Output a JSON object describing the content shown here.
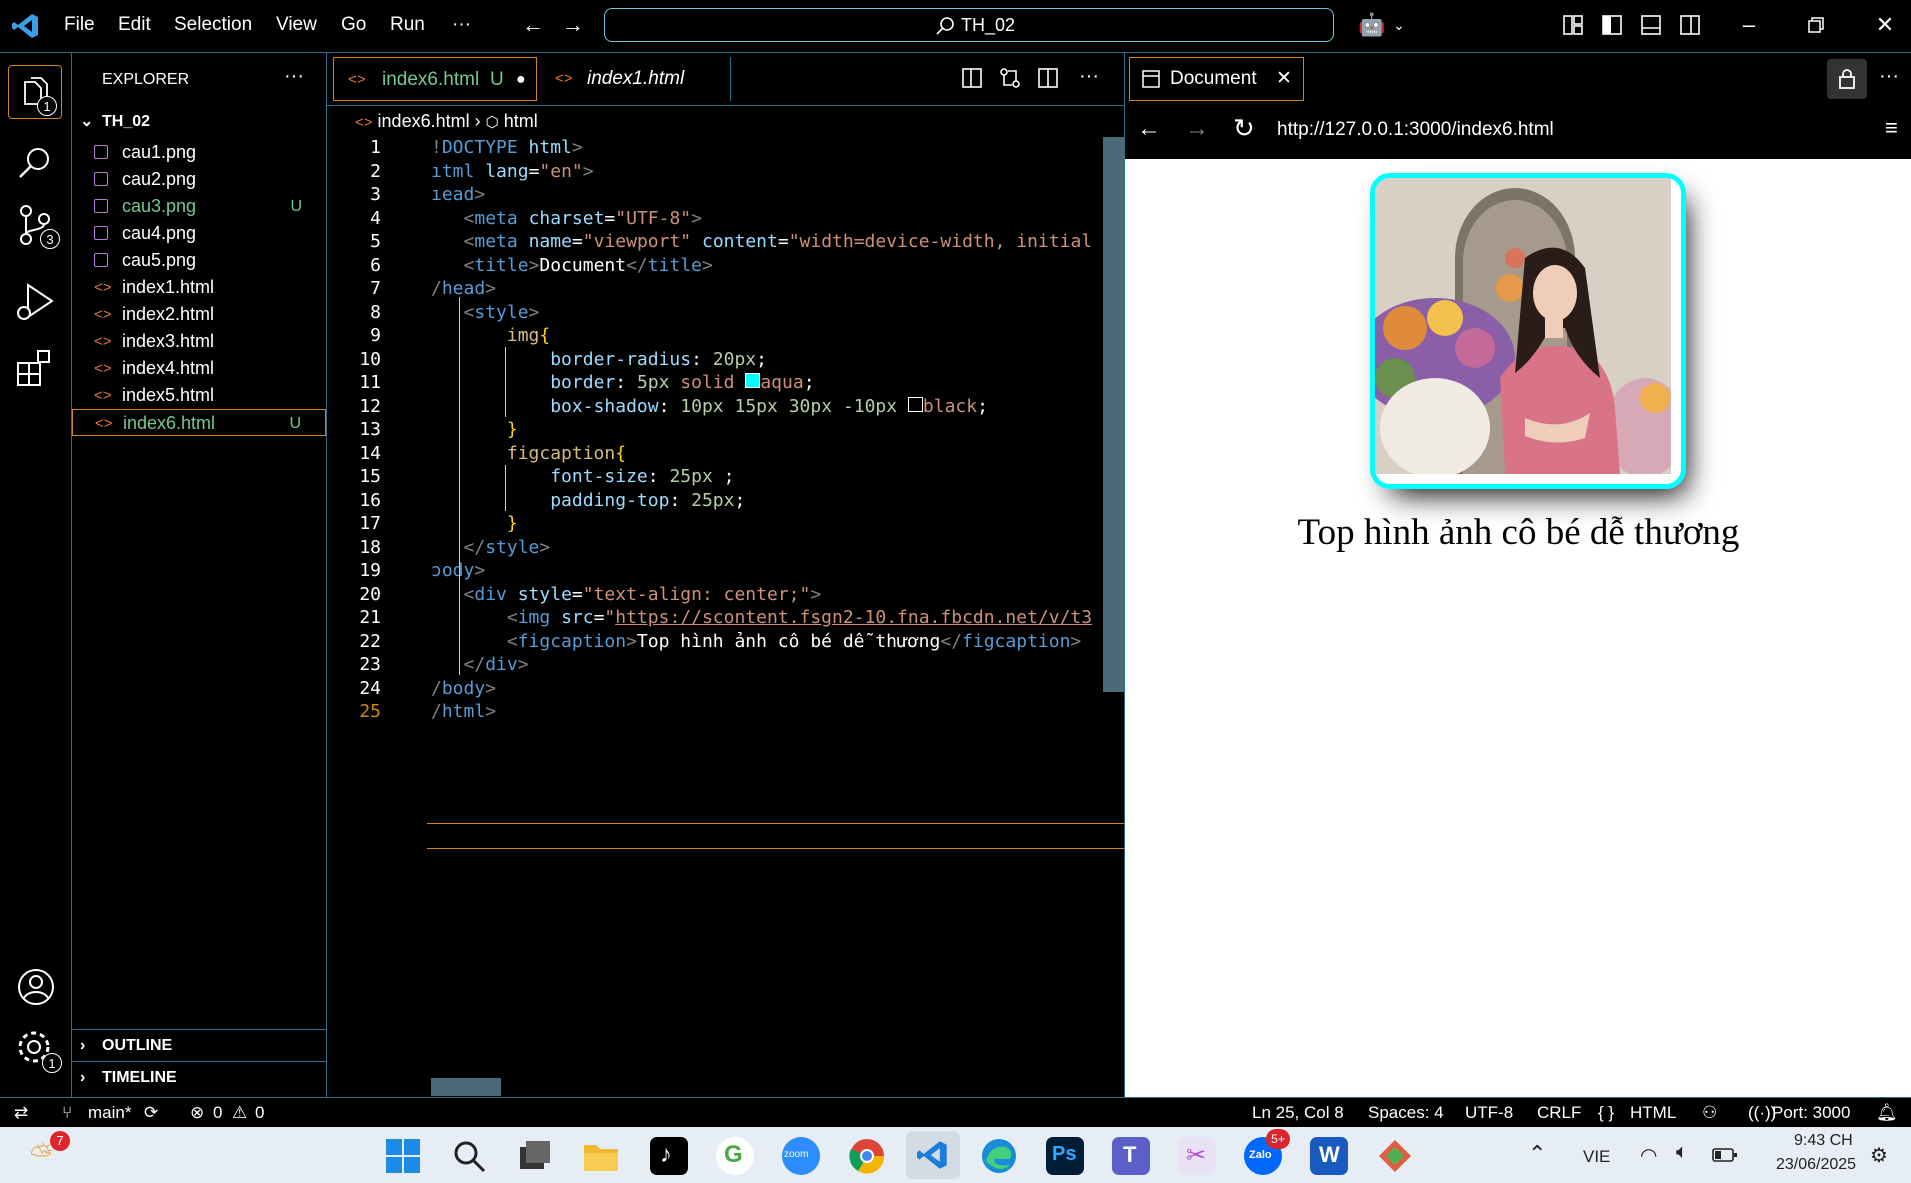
{
  "titlebar": {
    "menus": [
      "File",
      "Edit",
      "Selection",
      "View",
      "Go",
      "Run",
      "···"
    ],
    "search_text": "TH_02"
  },
  "activity": {
    "explorer_badge": "1",
    "scm_badge": "3",
    "settings_badge": "1"
  },
  "sidebar": {
    "title": "EXPLORER",
    "folder": "TH_02",
    "files": [
      {
        "name": "cau1.png",
        "status": ""
      },
      {
        "name": "cau2.png",
        "status": ""
      },
      {
        "name": "cau3.png",
        "status": "U"
      },
      {
        "name": "cau4.png",
        "status": ""
      },
      {
        "name": "cau5.png",
        "status": ""
      },
      {
        "name": "index1.html",
        "status": ""
      },
      {
        "name": "index2.html",
        "status": ""
      },
      {
        "name": "index3.html",
        "status": ""
      },
      {
        "name": "index4.html",
        "status": ""
      },
      {
        "name": "index5.html",
        "status": ""
      },
      {
        "name": "index6.html",
        "status": "U"
      }
    ],
    "outline": "OUTLINE",
    "timeline": "TIMELINE"
  },
  "editor": {
    "tabs": [
      {
        "label": "index6.html",
        "status": "U"
      },
      {
        "label": "index1.html",
        "status": ""
      }
    ],
    "breadcrumb": [
      "index6.html",
      "html"
    ],
    "line_numbers": [
      "1",
      "2",
      "3",
      "4",
      "5",
      "6",
      "7",
      "8",
      "9",
      "10",
      "11",
      "12",
      "13",
      "14",
      "15",
      "16",
      "17",
      "18",
      "19",
      "20",
      "21",
      "22",
      "23",
      "24",
      "25"
    ]
  },
  "preview": {
    "tab_label": "Document",
    "url": "http://127.0.0.1:3000/index6.html",
    "caption": "Top hình ảnh cô bé dễ thương"
  },
  "status": {
    "branch": "main*",
    "errors": "0",
    "warnings": "0",
    "position": "Ln 25, Col 8",
    "spaces": "Spaces: 4",
    "encoding": "UTF-8",
    "eol": "CRLF",
    "language": "HTML",
    "port": "Port: 3000"
  },
  "taskbar": {
    "weather_badge": "7",
    "zalo_badge": "5+",
    "lang": "VIE",
    "time": "9:43 CH",
    "date": "23/06/2025"
  },
  "colors": {
    "accent": "#6fc3df",
    "modified": "#73c991",
    "border_aqua": "#00ffff"
  }
}
